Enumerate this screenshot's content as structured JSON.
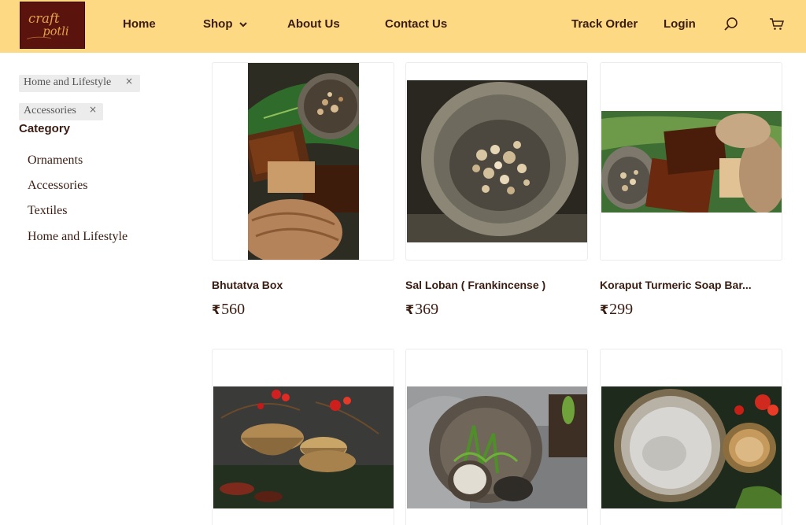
{
  "header": {
    "logo": {
      "line1": "craft",
      "line2": "potli"
    },
    "nav": {
      "home": "Home",
      "shop": "Shop",
      "about": "About Us",
      "contact": "Contact Us",
      "track": "Track Order",
      "login": "Login"
    },
    "icons": {
      "shop_caret": "chevron-down-icon",
      "search": "search-icon",
      "cart": "cart-icon"
    }
  },
  "filters": {
    "active": [
      {
        "label": "Home and Lifestyle",
        "remove": "×"
      },
      {
        "label": "Accessories",
        "remove": "×"
      }
    ],
    "category_title": "Category",
    "categories": [
      "Ornaments",
      "Accessories",
      "Textiles",
      "Home and Lifestyle"
    ]
  },
  "products": [
    {
      "name": "Bhutatva Box",
      "currency": "₹",
      "price": "560"
    },
    {
      "name": "Sal Loban ( Frankincense )",
      "currency": "₹",
      "price": "369"
    },
    {
      "name": "Koraput Turmeric Soap Bar...",
      "currency": "₹",
      "price": "299"
    },
    {
      "name": "",
      "currency": "",
      "price": ""
    },
    {
      "name": "",
      "currency": "",
      "price": ""
    },
    {
      "name": "",
      "currency": "",
      "price": ""
    }
  ],
  "colors": {
    "header_bg": "#fdd983",
    "text": "#3a1d12",
    "logo_bg": "#5a130d",
    "logo_text": "#e7a34a"
  }
}
